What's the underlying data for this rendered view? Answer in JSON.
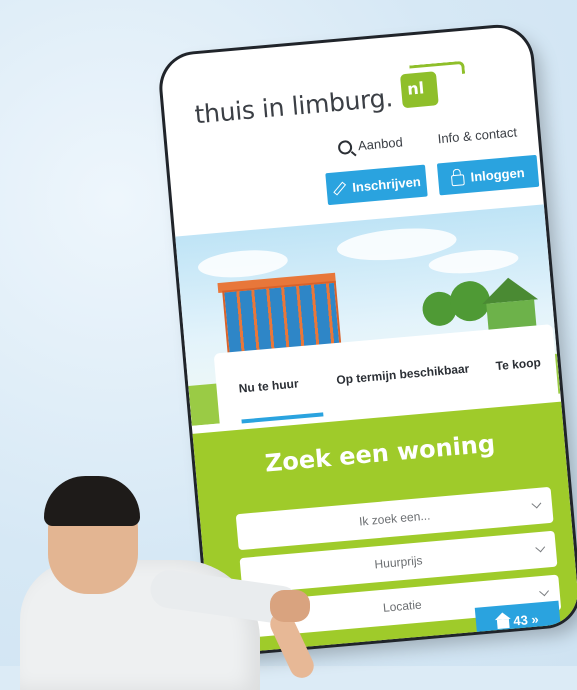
{
  "header": {
    "logo_text": "thuis in limburg.",
    "logo_badge": "nl"
  },
  "nav": {
    "search_label": "Aanbod",
    "info_label": "Info & contact"
  },
  "buttons": {
    "register_label": "Inschrijven",
    "login_label": "Inloggen"
  },
  "tabs": [
    {
      "label": "Nu te huur",
      "active": true
    },
    {
      "label": "Op termijn beschikbaar",
      "active": false
    },
    {
      "label": "Te koop",
      "active": false
    }
  ],
  "search": {
    "title": "Zoek een woning",
    "selects": [
      {
        "value": "Ik zoek een..."
      },
      {
        "value": "Huurprijs"
      },
      {
        "value": "Locatie"
      }
    ],
    "result_count": "43 »"
  },
  "colors": {
    "accent_blue": "#2aa3df",
    "brand_green": "#9fcb2a"
  },
  "icons": [
    "search-icon",
    "pencil-icon",
    "lock-icon",
    "chevron-down-icon",
    "home-icon"
  ]
}
